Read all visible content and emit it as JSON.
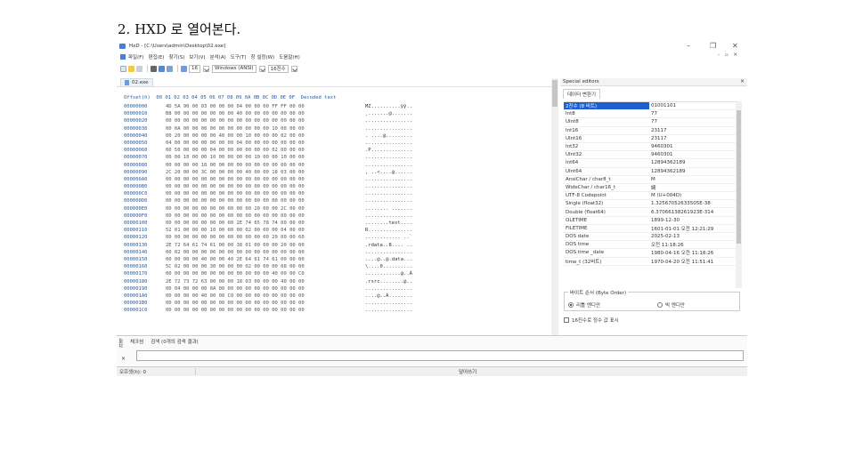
{
  "page_heading": "2. HXD 로 열어본다.",
  "window": {
    "title": "HxD - [C:\\Users\\admin\\Desktop\\02.exe]",
    "controls": {
      "minimize": "–",
      "restore": "❐",
      "close": "✕"
    }
  },
  "menu": {
    "items": [
      "파일(F)",
      "편집(E)",
      "찾기(S)",
      "보기(V)",
      "분석(A)",
      "도구(T)",
      "창 설정(W)",
      "도움말(H)"
    ],
    "right_controls": "- ▫ ✕"
  },
  "toolbar": {
    "columns_value": "16",
    "charset_value": "Windows (ANSI)",
    "display_value": "16진수"
  },
  "file_tab": {
    "label": "02.exe"
  },
  "hex_view": {
    "header": "Offset(h)  00 01 02 03 04 05 06 07 08 09 0A 0B 0C 0D 0E 0F  Decoded text",
    "rows": [
      {
        "offset": "00000000",
        "bytes": "4D 5A 90 00 03 00 00 00 04 00 00 00 FF FF 00 00",
        "text": "MZ..........ÿÿ.."
      },
      {
        "offset": "00000010",
        "bytes": "B8 00 00 00 00 00 00 00 40 00 00 00 00 00 00 00",
        "text": "¸.......@......."
      },
      {
        "offset": "00000020",
        "bytes": "00 00 00 00 00 00 00 00 00 00 00 00 00 00 00 00",
        "text": "................"
      },
      {
        "offset": "00000030",
        "bytes": "00 0A 00 00 00 00 00 00 00 00 00 00 10 00 00 00",
        "text": "................"
      },
      {
        "offset": "00000040",
        "bytes": "00 20 00 00 00 00 40 00 00 10 00 00 00 02 00 00",
        "text": ". ....@........."
      },
      {
        "offset": "00000050",
        "bytes": "04 00 00 00 00 00 00 00 04 00 00 00 00 00 00 00",
        "text": "................"
      },
      {
        "offset": "00000060",
        "bytes": "00 50 00 00 00 04 00 00 00 00 00 00 02 00 00 00",
        "text": ".P.............."
      },
      {
        "offset": "00000070",
        "bytes": "00 00 10 00 00 10 00 00 00 00 10 00 00 10 00 00",
        "text": "................"
      },
      {
        "offset": "00000080",
        "bytes": "00 00 00 00 10 00 00 00 00 00 00 00 00 00 00 00",
        "text": "................"
      },
      {
        "offset": "00000090",
        "bytes": "2C 20 00 00 3C 00 00 00 00 40 00 00 18 03 00 00",
        "text": ", ..<....@......"
      },
      {
        "offset": "000000A0",
        "bytes": "00 00 00 00 00 00 00 00 00 00 00 00 00 00 00 00",
        "text": "................"
      },
      {
        "offset": "000000B0",
        "bytes": "00 00 00 00 00 00 00 00 00 00 00 00 00 00 00 00",
        "text": "................"
      },
      {
        "offset": "000000C0",
        "bytes": "00 00 00 00 00 00 00 00 00 00 00 00 00 00 00 00",
        "text": "................"
      },
      {
        "offset": "000000D0",
        "bytes": "00 00 00 00 00 00 00 00 00 00 00 00 00 00 00 00",
        "text": "................"
      },
      {
        "offset": "000000E0",
        "bytes": "00 00 00 00 00 00 00 00 00 00 20 00 00 2C 00 00",
        "text": "........ ..,...."
      },
      {
        "offset": "000000F0",
        "bytes": "00 00 00 00 00 00 00 00 00 00 00 00 00 00 00 00",
        "text": "................"
      },
      {
        "offset": "00000100",
        "bytes": "00 00 00 00 00 00 00 00 2E 74 65 78 74 00 00 00",
        "text": "........text...."
      },
      {
        "offset": "00000110",
        "bytes": "52 01 00 00 00 10 00 00 00 02 00 00 00 04 00 00",
        "text": "R..............."
      },
      {
        "offset": "00000120",
        "bytes": "00 00 00 00 00 00 00 00 00 00 00 00 20 00 00 60",
        "text": "............ ..`"
      },
      {
        "offset": "00000130",
        "bytes": "2E 72 64 61 74 61 00 00 38 01 00 00 00 20 00 00",
        "text": ".rdata..8.... .."
      },
      {
        "offset": "00000140",
        "bytes": "00 02 00 00 00 06 00 00 00 00 00 00 00 00 00 00",
        "text": "................"
      },
      {
        "offset": "00000150",
        "bytes": "00 00 00 00 40 00 00 40 2E 64 61 74 61 00 00 00",
        "text": "....@..@.data..."
      },
      {
        "offset": "00000160",
        "bytes": "5C 02 00 00 00 30 00 00 00 02 00 00 00 08 00 00",
        "text": "\\....0.........."
      },
      {
        "offset": "00000170",
        "bytes": "00 00 00 00 00 00 00 00 00 00 00 00 40 00 00 C0",
        "text": "............@..À"
      },
      {
        "offset": "00000180",
        "bytes": "2E 72 73 72 63 00 00 00 18 03 00 00 00 40 00 00",
        "text": ".rsrc........@.."
      },
      {
        "offset": "00000190",
        "bytes": "00 04 00 00 00 0A 00 00 00 00 00 00 00 00 00 00",
        "text": "................"
      },
      {
        "offset": "000001A0",
        "bytes": "00 00 00 00 40 00 00 C0 00 00 00 00 00 00 00 00",
        "text": "....@..À........"
      },
      {
        "offset": "000001B0",
        "bytes": "00 00 00 00 00 00 00 00 00 00 00 00 00 00 00 00",
        "text": "................"
      },
      {
        "offset": "000001C0",
        "bytes": "00 00 00 00 00 00 00 00 00 00 00 00 00 00 00 00",
        "text": "................"
      }
    ]
  },
  "special_editors": {
    "title": "Special editors",
    "close": "×",
    "tab": "데이터 변환기",
    "rows": [
      {
        "key": "2진수 (8 비트)",
        "value": "01001101",
        "selected": true
      },
      {
        "key": "Int8",
        "value": "77"
      },
      {
        "key": "UInt8",
        "value": "77"
      },
      {
        "key": "Int16",
        "value": "23117"
      },
      {
        "key": "UInt16",
        "value": "23117"
      },
      {
        "key": "Int32",
        "value": "9460301"
      },
      {
        "key": "UInt32",
        "value": "9460301"
      },
      {
        "key": "Int64",
        "value": "12894362189"
      },
      {
        "key": "UInt64",
        "value": "12894362189"
      },
      {
        "key": "AnsiChar / char8_t",
        "value": "M"
      },
      {
        "key": "WideChar / char16_t",
        "value": "婍"
      },
      {
        "key": "UTF-8 Codepoint",
        "value": "M (U+004D)"
      },
      {
        "key": "Single (float32)",
        "value": "1.32567052633505E-38"
      },
      {
        "key": "Double (float64)",
        "value": "6.37066138261923E-314"
      },
      {
        "key": "OLETIME",
        "value": "1899-12-30"
      },
      {
        "key": "FILETIME",
        "value": "1601-01-01 오전 12:21:29"
      },
      {
        "key": "DOS date",
        "value": "2025-02-13"
      },
      {
        "key": "DOS time",
        "value": "오전 11:18:26"
      },
      {
        "key": "DOS time _date",
        "value": "1980-04-16 오전 11:18:26"
      },
      {
        "key": "time_t (32비트)",
        "value": "1970-04-20 오전 11:51:41"
      }
    ],
    "byte_order_label": "바이트 순서 (Byte Order)",
    "little_endian": "리틀 엔디안",
    "big_endian": "빅 엔디안",
    "hex_int_label": "16진수로 정수 값 표시"
  },
  "bottom_panel": {
    "side_label": "검색",
    "tabs": [
      "체크섬",
      "검색 (0개의 검색 결과)"
    ],
    "close": "×"
  },
  "status": {
    "offset": "오프셋(h): 0",
    "mode": "덮어쓰기"
  }
}
